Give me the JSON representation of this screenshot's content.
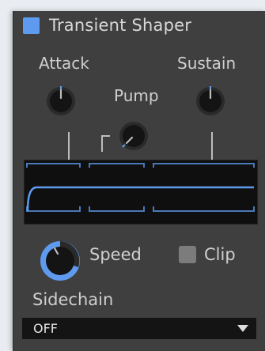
{
  "header": {
    "title": "Transient Shaper",
    "enabled": true,
    "accent_color": "#5e9bef"
  },
  "knobs": {
    "attack": {
      "label": "Attack",
      "value": 0.5
    },
    "pump": {
      "label": "Pump",
      "value": 0.0
    },
    "sustain": {
      "label": "Sustain",
      "value": 0.5
    },
    "speed": {
      "label": "Speed",
      "value": 0.22
    }
  },
  "clip": {
    "label": "Clip",
    "checked": false
  },
  "sidechain": {
    "label": "Sidechain",
    "selected": "OFF"
  },
  "icons": {
    "dropdown_arrow": "chevron-down-icon",
    "checkbox": "checkbox-icon"
  }
}
